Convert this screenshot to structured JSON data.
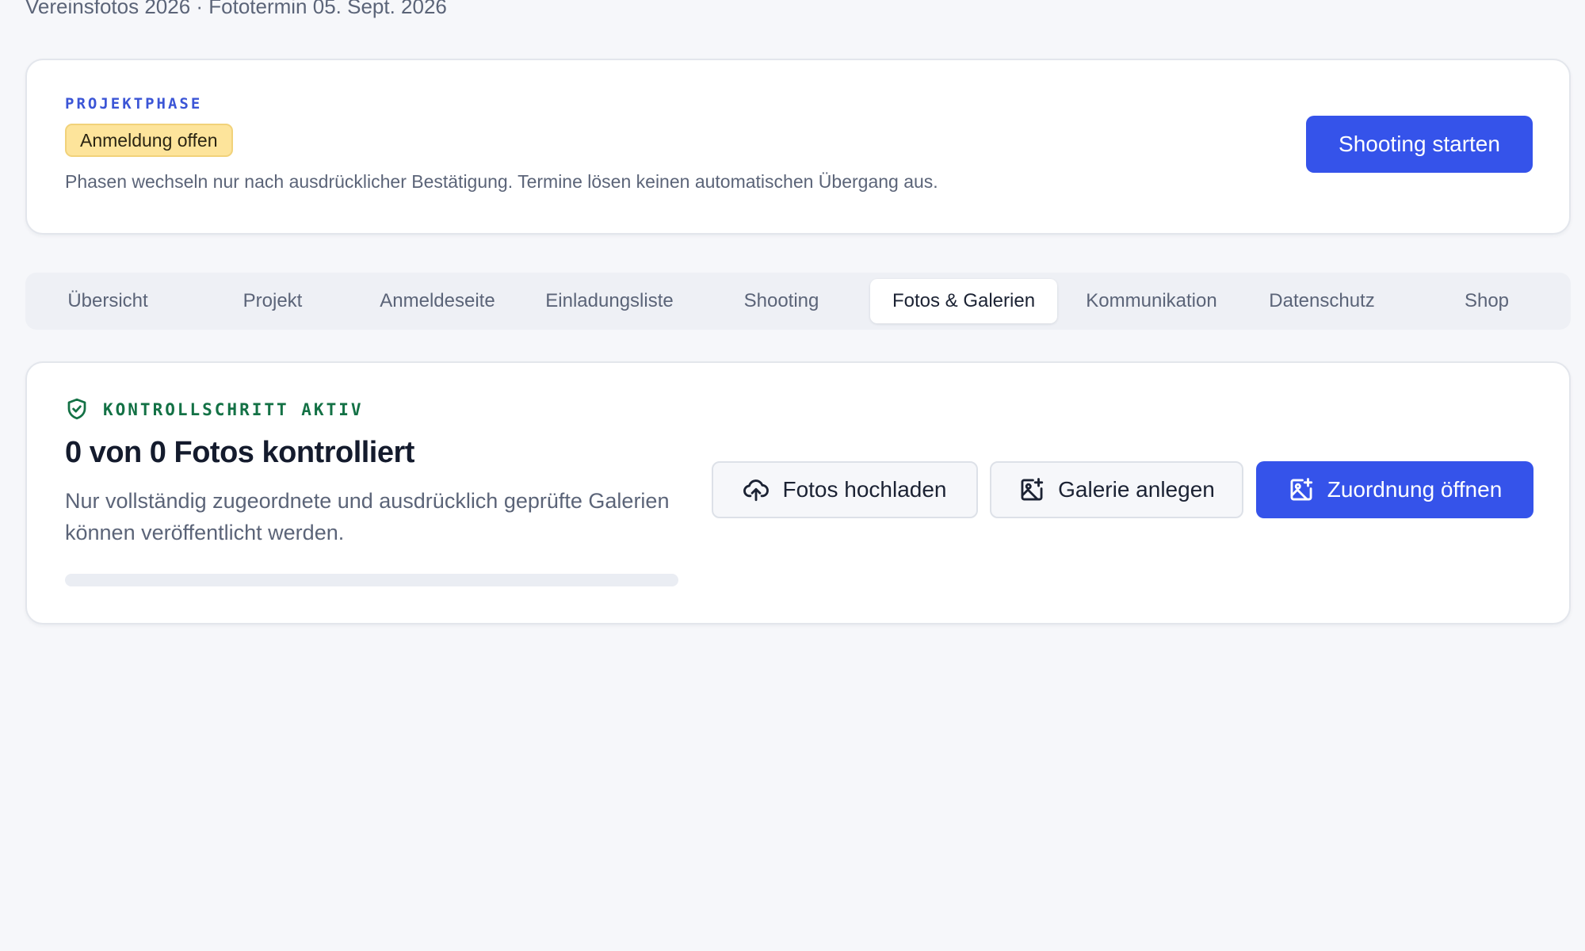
{
  "header": {
    "subtitle": "Vereinsfotos 2026 · Fototermin 05. Sept. 2026"
  },
  "phase": {
    "eyebrow": "PROJEKTPHASE",
    "status_badge": "Anmeldung offen",
    "note": "Phasen wechseln nur nach ausdrücklicher Bestätigung. Termine lösen keinen automatischen Übergang aus.",
    "start_button": "Shooting starten"
  },
  "tabs": [
    {
      "label": "Übersicht",
      "active": false
    },
    {
      "label": "Projekt",
      "active": false
    },
    {
      "label": "Anmeldeseite",
      "active": false
    },
    {
      "label": "Einladungsliste",
      "active": false
    },
    {
      "label": "Shooting",
      "active": false
    },
    {
      "label": "Fotos & Galerien",
      "active": true
    },
    {
      "label": "Kommunikation",
      "active": false
    },
    {
      "label": "Datenschutz",
      "active": false
    },
    {
      "label": "Shop",
      "active": false
    }
  ],
  "control": {
    "eyebrow": "KONTROLLSCHRITT AKTIV",
    "icon": "shield-check-icon",
    "title": "0 von 0 Fotos kontrolliert",
    "description": "Nur vollständig zugeordnete und ausdrücklich geprüfte Galerien können veröffentlicht werden.",
    "progress_fraction": 0,
    "buttons": {
      "upload": {
        "label": "Fotos hochladen",
        "icon": "cloud-upload-icon"
      },
      "gallery": {
        "label": "Galerie anlegen",
        "icon": "image-plus-icon"
      },
      "assign": {
        "label": "Zuordnung öffnen",
        "icon": "image-plus-icon"
      }
    }
  },
  "colors": {
    "accent": "#3553ea",
    "badge_bg": "#fde49b",
    "success": "#137145",
    "background": "#f6f7fa"
  }
}
